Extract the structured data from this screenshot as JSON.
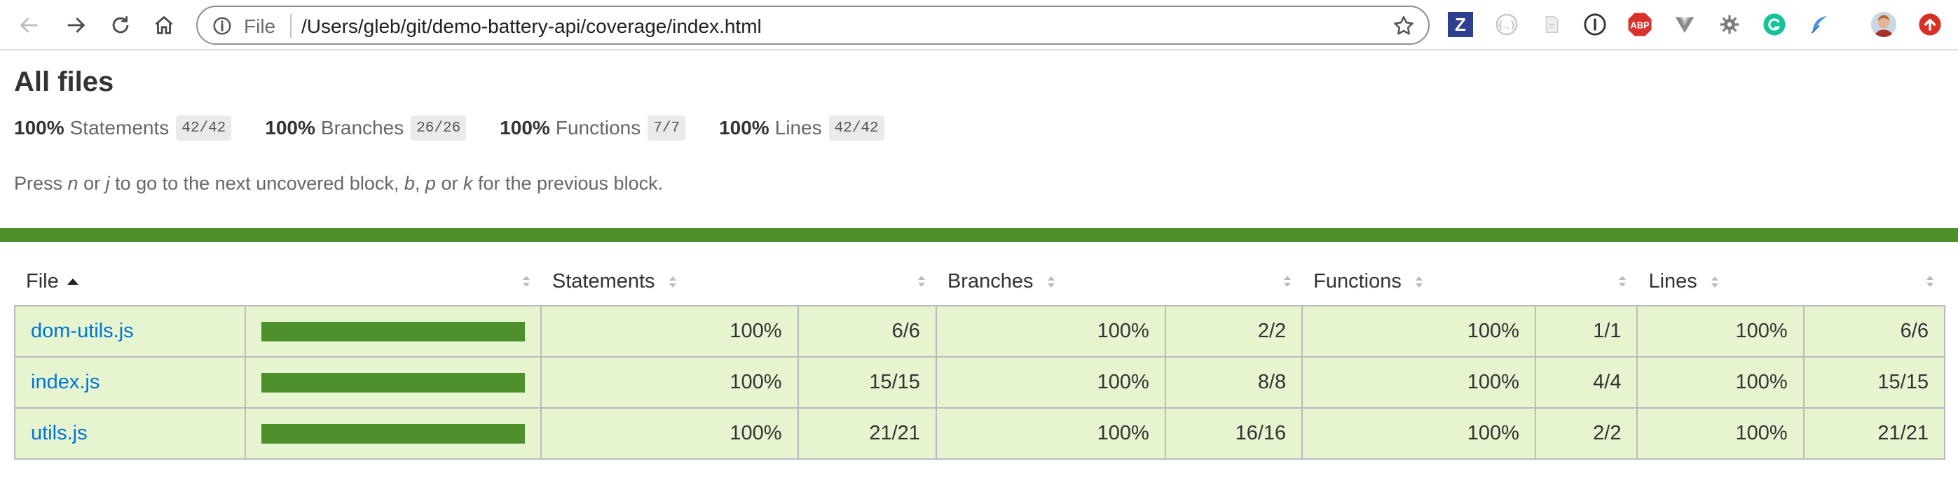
{
  "browser": {
    "address_scheme": "File",
    "address_url": "/Users/gleb/git/demo-battery-api/coverage/index.html",
    "extensions": [
      "zotero-icon",
      "json-viewer-icon",
      "pdf-extension-icon",
      "onepassword-icon",
      "adblock-plus-icon",
      "vue-devtools-icon",
      "settings-cog-icon",
      "grammarly-icon",
      "feather-icon",
      "profile-avatar",
      "update-icon"
    ],
    "adblock_label": "ABP",
    "zotero_label": "Z"
  },
  "page": {
    "title": "All files",
    "summary": [
      {
        "pct": "100%",
        "label": "Statements",
        "fraction": "42/42"
      },
      {
        "pct": "100%",
        "label": "Branches",
        "fraction": "26/26"
      },
      {
        "pct": "100%",
        "label": "Functions",
        "fraction": "7/7"
      },
      {
        "pct": "100%",
        "label": "Lines",
        "fraction": "42/42"
      }
    ],
    "hint": {
      "p1": "Press ",
      "k1": "n",
      "p2": " or ",
      "k2": "j",
      "p3": " to go to the next uncovered block, ",
      "k3": "b",
      "p4": ", ",
      "k4": "p",
      "p5": " or ",
      "k5": "k",
      "p6": " for the previous block."
    },
    "status_color": "#4d8f2a"
  },
  "table": {
    "headers": {
      "file": "File",
      "statements": "Statements",
      "branches": "Branches",
      "functions": "Functions",
      "lines": "Lines"
    },
    "rows": [
      {
        "file": "dom-utils.js",
        "coverage": 1.0,
        "statements_pct": "100%",
        "statements": "6/6",
        "branches_pct": "100%",
        "branches": "2/2",
        "functions_pct": "100%",
        "functions": "1/1",
        "lines_pct": "100%",
        "lines": "6/6"
      },
      {
        "file": "index.js",
        "coverage": 1.0,
        "statements_pct": "100%",
        "statements": "15/15",
        "branches_pct": "100%",
        "branches": "8/8",
        "functions_pct": "100%",
        "functions": "4/4",
        "lines_pct": "100%",
        "lines": "15/15"
      },
      {
        "file": "utils.js",
        "coverage": 1.0,
        "statements_pct": "100%",
        "statements": "21/21",
        "branches_pct": "100%",
        "branches": "16/16",
        "functions_pct": "100%",
        "functions": "2/2",
        "lines_pct": "100%",
        "lines": "21/21"
      }
    ]
  }
}
